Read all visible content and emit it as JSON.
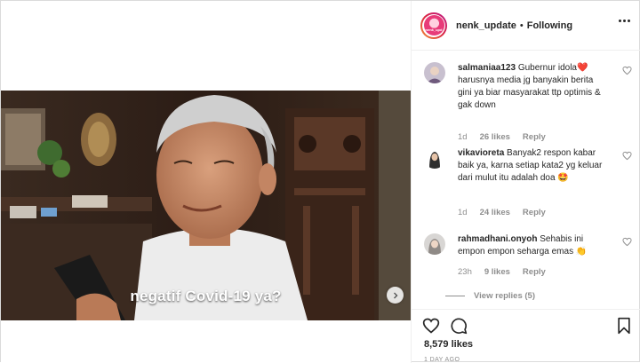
{
  "video": {
    "caption": "negatif Covid-19 ya?"
  },
  "header": {
    "username": "nenk_update",
    "separator": "•",
    "follow_status": "Following",
    "avatar_text": "nenk_upd"
  },
  "comments": [
    {
      "username": "salmaniaa123",
      "text": "Gubernur idola❤️ harusnya media jg banyakin berita gini ya biar masyarakat ttp optimis & gak down",
      "time": "1d",
      "likes": "26 likes",
      "reply": "Reply"
    },
    {
      "username": "vikavioreta",
      "text": "Banyak2 respon kabar baik ya, karna setiap kata2 yg keluar dari mulut itu adalah doa 🤩",
      "time": "1d",
      "likes": "24 likes",
      "reply": "Reply"
    },
    {
      "username": "rahmadhani.onyoh",
      "text": "Sehabis ini empon empon seharga emas 👏",
      "time": "23h",
      "likes": "9 likes",
      "reply": "Reply"
    }
  ],
  "view_replies": "View replies (5)",
  "post": {
    "likes": "8,579 likes",
    "time_ago": "1 DAY AGO"
  },
  "colors": {
    "text": "#262626",
    "muted": "#8e8e8e",
    "heart_red": "#ed4956"
  }
}
